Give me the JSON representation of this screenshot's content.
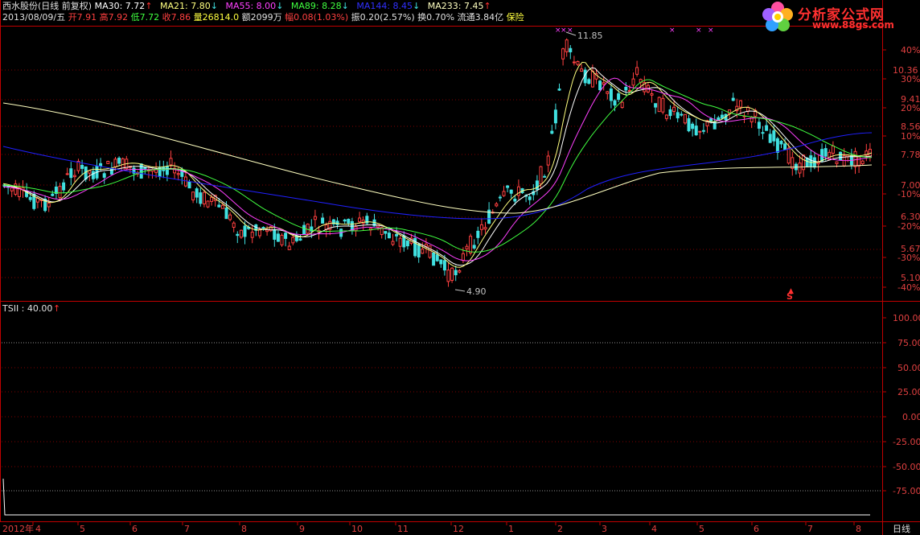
{
  "header": {
    "stock_name": "西水股份(日线 前复权)",
    "ma30": "MA30: 7.72",
    "ma21": "MA21: 7.80",
    "ma55": "MA55: 8.00",
    "ma89": "MA89: 8.28",
    "ma144": "MA144: 8.45",
    "ma233": "MA233: 7.45",
    "date": "2013/08/09/五",
    "open": "开7.91",
    "high": "高7.92",
    "low": "低7.72",
    "close": "收7.86",
    "volume": "量26814.0",
    "amount": "额2099万",
    "change": "幅0.08(1.03%)",
    "amplitude": "振0.20(2.57%)",
    "turnover": "换0.70%",
    "float_cap": "流通3.84亿",
    "industry": "保险"
  },
  "logo": {
    "text": "分析家公式网",
    "url": "www.88gs.com"
  },
  "price_axis": [
    "40%",
    "10.36",
    "30%",
    "9.41",
    "20%",
    "8.56",
    "10%",
    "7.78",
    "7.00",
    "-10%",
    "6.30",
    "-20%",
    "5.67",
    "-30%",
    "5.10",
    "-40%"
  ],
  "annotations": {
    "high": "11.85",
    "low": "4.90",
    "s_mark": "S"
  },
  "indicator": {
    "label": "TSII : 40.00",
    "axis": [
      "100.00",
      "75.00",
      "50.00",
      "25.00",
      "0.00",
      "-25.00",
      "-50.00",
      "-75.00"
    ]
  },
  "time_axis": [
    "2012年",
    "4",
    "5",
    "6",
    "7",
    "8",
    "9",
    "10",
    "11",
    "12",
    "1",
    "2",
    "3",
    "4",
    "5",
    "6",
    "7",
    "8"
  ],
  "period_label": "日线",
  "colors": {
    "up": "#ff4040",
    "down": "#40e0e0",
    "ma30": "#ffffff",
    "ma21": "#ffff80",
    "ma55": "#ff40ff",
    "ma89": "#40ff40",
    "ma144": "#2020ff",
    "ma233": "#ffffc0",
    "axis_red": "#c00000"
  }
}
